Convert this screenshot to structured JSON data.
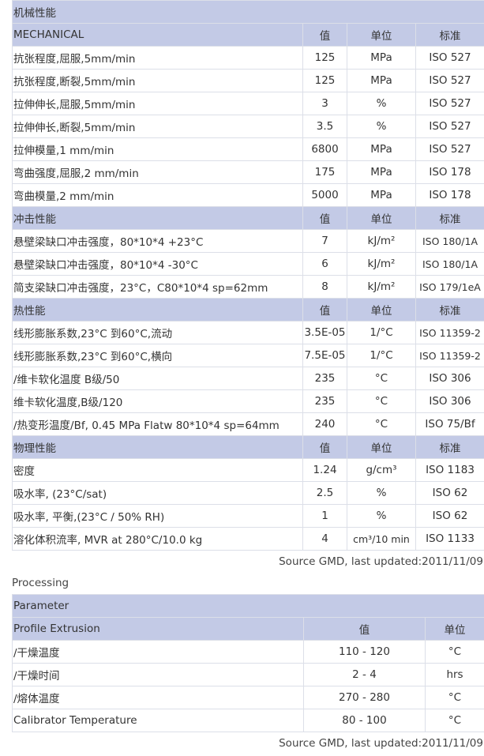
{
  "properties_table": {
    "title": "机械性能",
    "sections": [
      {
        "name": "MECHANICAL",
        "col_value": "值",
        "col_unit": "单位",
        "col_std": "标准",
        "rows": [
          {
            "name": "抗张程度,屈服,5mm/min",
            "value": "125",
            "unit": "MPa",
            "std": "ISO 527"
          },
          {
            "name": "抗张程度,断裂,5mm/min",
            "value": "125",
            "unit": "MPa",
            "std": "ISO 527"
          },
          {
            "name": "拉伸伸长,屈服,5mm/min",
            "value": "3",
            "unit": "%",
            "std": "ISO 527"
          },
          {
            "name": "拉伸伸长,断裂,5mm/min",
            "value": "3.5",
            "unit": "%",
            "std": "ISO 527"
          },
          {
            "name": "拉伸模量,1 mm/min",
            "value": "6800",
            "unit": "MPa",
            "std": "ISO 527"
          },
          {
            "name": "弯曲强度,屈服,2 mm/min",
            "value": "175",
            "unit": "MPa",
            "std": "ISO 178"
          },
          {
            "name": "弯曲模量,2 mm/min",
            "value": "5000",
            "unit": "MPa",
            "std": "ISO 178"
          }
        ]
      },
      {
        "name": "冲击性能",
        "col_value": "值",
        "col_unit": "单位",
        "col_std": "标准",
        "rows": [
          {
            "name": "悬壁梁缺口冲击强度，80*10*4 +23°C",
            "value": "7",
            "unit": "kJ/m²",
            "std": "ISO 180/1A"
          },
          {
            "name": "悬壁梁缺口冲击强度，80*10*4 -30°C",
            "value": "6",
            "unit": "kJ/m²",
            "std": "ISO 180/1A"
          },
          {
            "name": "简支梁缺口冲击强度，23°C，C80*10*4 sp=62mm",
            "value": "8",
            "unit": "kJ/m²",
            "std": "ISO 179/1eA"
          }
        ]
      },
      {
        "name": "热性能",
        "col_value": "值",
        "col_unit": "单位",
        "col_std": "标准",
        "rows": [
          {
            "name": "线形膨胀系数,23°C 到60°C,流动",
            "value": "3.5E-05",
            "unit": "1/°C",
            "std": "ISO 11359-2"
          },
          {
            "name": "线形膨胀系数,23°C 到60°C,横向",
            "value": "7.5E-05",
            "unit": "1/°C",
            "std": "ISO 11359-2"
          },
          {
            "name": "/维卡软化温度 B级/50",
            "value": "235",
            "unit": "°C",
            "std": "ISO 306"
          },
          {
            "name": "维卡软化温度,B级/120",
            "value": "235",
            "unit": "°C",
            "std": "ISO 306"
          },
          {
            "name": "/热变形温度/Bf, 0.45 MPa Flatw 80*10*4 sp=64mm",
            "value": "240",
            "unit": "°C",
            "std": "ISO 75/Bf"
          }
        ]
      },
      {
        "name": "物理性能",
        "col_value": "值",
        "col_unit": "单位",
        "col_std": "标准",
        "rows": [
          {
            "name": "密度",
            "value": "1.24",
            "unit": "g/cm³",
            "std": "ISO 1183"
          },
          {
            "name": "吸水率, (23°C/sat)",
            "value": "2.5",
            "unit": "%",
            "std": "ISO 62"
          },
          {
            "name": "吸水率, 平衡,(23°C / 50% RH)",
            "value": "1",
            "unit": "%",
            "std": "ISO 62"
          },
          {
            "name": "溶化体积流率, MVR at 280°C/10.0 kg",
            "value": "4",
            "unit": "cm³/10 min",
            "std": "ISO 1133"
          }
        ]
      }
    ],
    "source": "Source GMD, last updated:2011/11/09"
  },
  "processing": {
    "title": "Processing",
    "header": "Parameter",
    "subheader": "Profile Extrusion",
    "col_value": "值",
    "col_unit": "单位",
    "rows": [
      {
        "name": "/干燥温度",
        "value": "110 - 120",
        "unit": "°C"
      },
      {
        "name": "/干燥时间",
        "value": "2 - 4",
        "unit": "hrs"
      },
      {
        "name": "/熔体温度",
        "value": "270 - 280",
        "unit": "°C"
      },
      {
        "name": "Calibrator Temperature",
        "value": "80 - 100",
        "unit": "°C"
      }
    ],
    "source": "Source GMD, last updated:2011/11/09"
  }
}
